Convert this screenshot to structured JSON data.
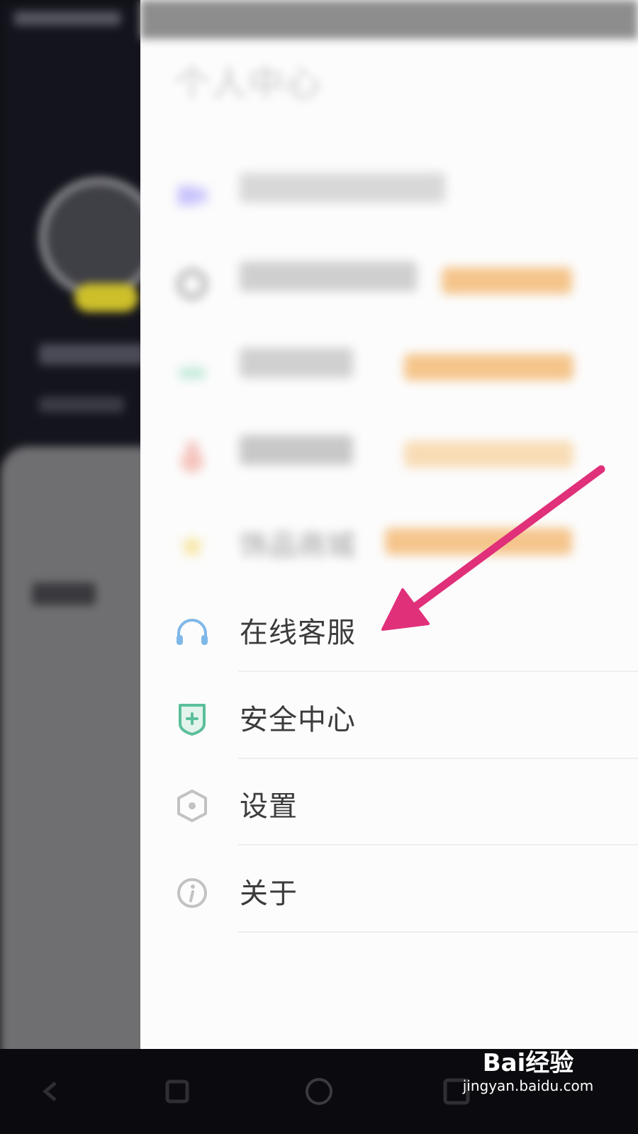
{
  "drawer": {
    "title": "个人中心",
    "items": [
      {
        "label": "",
        "tag": "",
        "icon": "video-icon",
        "color": "#8d86f0"
      },
      {
        "label": "",
        "tag": "",
        "icon": "gift-icon",
        "color": "#9a9a9a"
      },
      {
        "label": "",
        "tag": "",
        "icon": "crown-icon",
        "color": "#8fd3b8"
      },
      {
        "label": "",
        "tag": "",
        "icon": "medal-icon",
        "color": "#f0a8a0"
      },
      {
        "label": "饰品商城",
        "tag": "",
        "icon": "star-icon",
        "color": "#f2d44e"
      },
      {
        "label": "在线客服",
        "icon": "headset-icon",
        "color": "#7fb7e8"
      },
      {
        "label": "安全中心",
        "icon": "shield-icon",
        "color": "#5bbf9b"
      },
      {
        "label": "设置",
        "icon": "hexagon-gear-icon",
        "color": "#c2c2c2"
      },
      {
        "label": "关于",
        "icon": "info-icon",
        "color": "#c2c2c2"
      }
    ]
  },
  "annotation": {
    "color": "#e0307a",
    "icon": "arrow-pointer-icon"
  },
  "watermark": {
    "brand": "Bai经验",
    "url": "jingyan.baidu.com"
  },
  "colors": {
    "drawer_bg": "#fcfcfc",
    "overlay": "#0d0d12",
    "tag_bg": "#f5c58c"
  }
}
